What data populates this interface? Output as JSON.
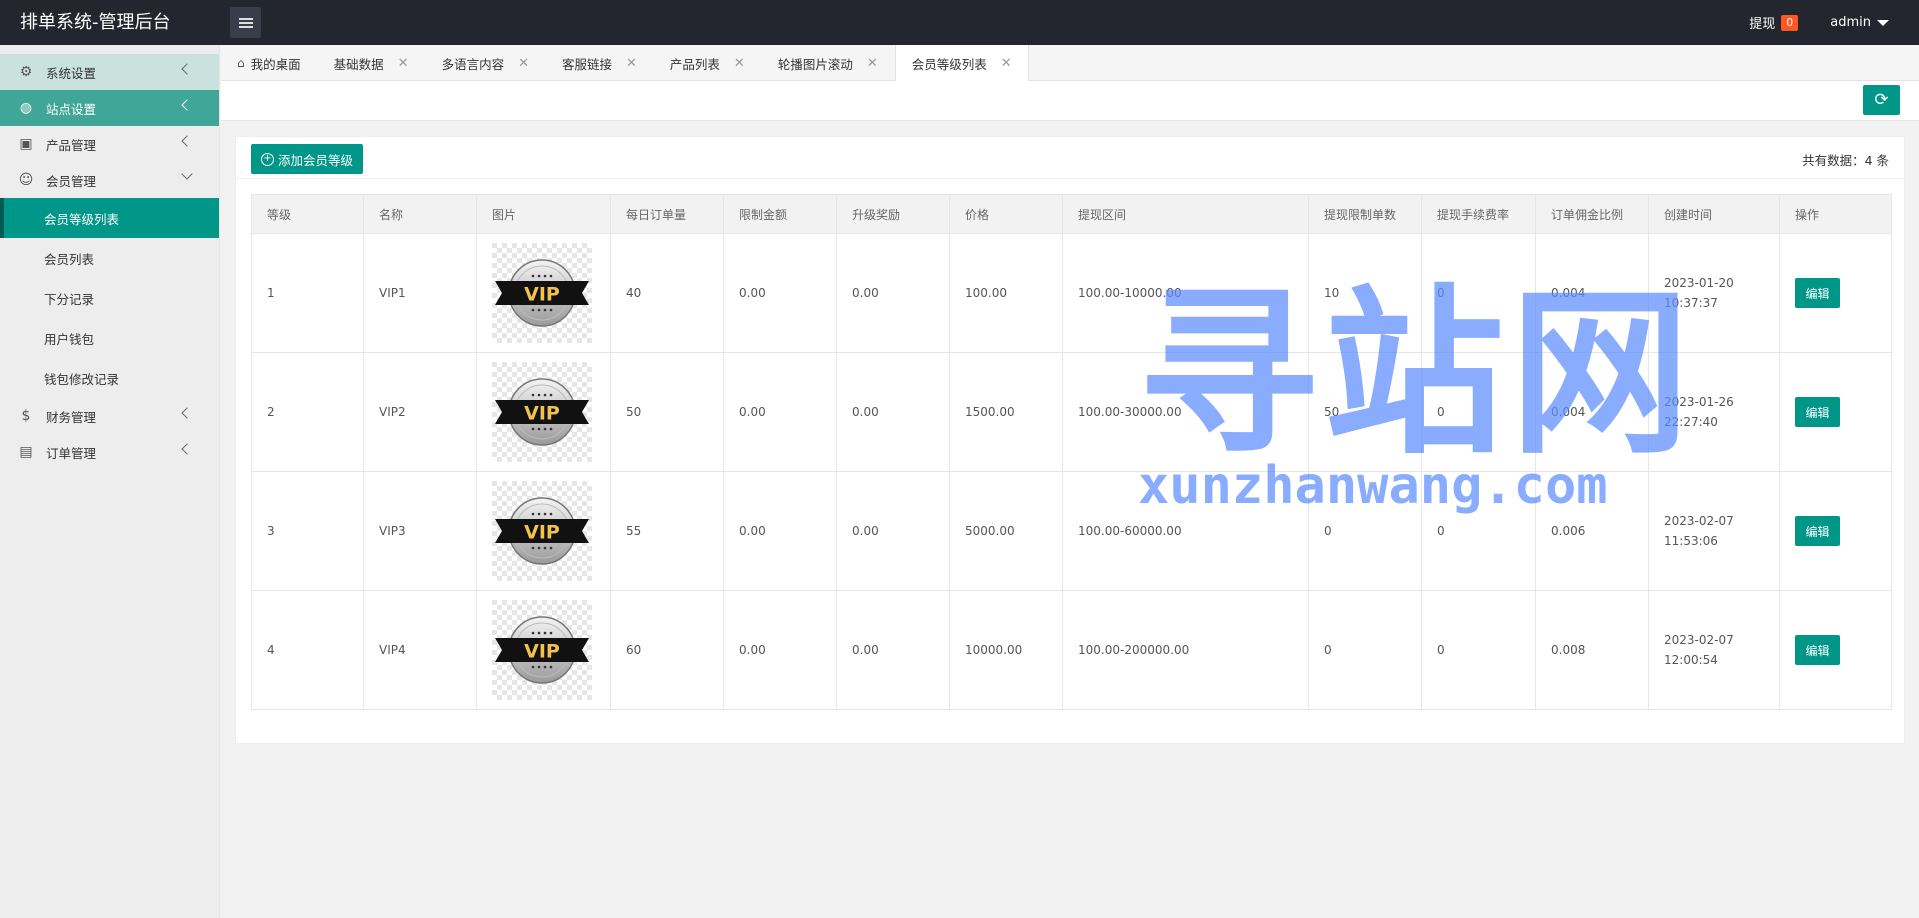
{
  "header": {
    "title": "排单系统-管理后台",
    "withdraw_label": "提现",
    "withdraw_badge": "0",
    "user": "admin"
  },
  "sidebar": {
    "items": [
      {
        "label": "系统设置",
        "icon": "gear-icon"
      },
      {
        "label": "站点设置",
        "icon": "globe-icon"
      },
      {
        "label": "产品管理",
        "icon": "box-icon"
      },
      {
        "label": "会员管理",
        "icon": "user-icon"
      },
      {
        "label": "财务管理",
        "icon": "dollar-icon"
      },
      {
        "label": "订单管理",
        "icon": "package-icon"
      }
    ],
    "subitems": [
      "会员等级列表",
      "会员列表",
      "下分记录",
      "用户钱包",
      "钱包修改记录"
    ]
  },
  "tabs": [
    "我的桌面",
    "基础数据",
    "多语言内容",
    "客服链接",
    "产品列表",
    "轮播图片滚动",
    "会员等级列表"
  ],
  "toolbar": {
    "add_label": "添加会员等级",
    "total_text": "共有数据：4 条"
  },
  "table": {
    "headers": [
      "等级",
      "名称",
      "图片",
      "每日订单量",
      "限制金额",
      "升级奖励",
      "价格",
      "提现区间",
      "提现限制单数",
      "提现手续费率",
      "订单佣金比例",
      "创建时间",
      "操作"
    ],
    "edit_label": "编辑",
    "vip_badge_text": "VIP",
    "rows": [
      {
        "level": "1",
        "name": "VIP1",
        "daily": "40",
        "limit": "0.00",
        "reward": "0.00",
        "price": "100.00",
        "range": "100.00-10000.00",
        "wd_count": "10",
        "fee": "0",
        "commission": "0.004",
        "time": "2023-01-20 10:37:37"
      },
      {
        "level": "2",
        "name": "VIP2",
        "daily": "50",
        "limit": "0.00",
        "reward": "0.00",
        "price": "1500.00",
        "range": "100.00-30000.00",
        "wd_count": "50",
        "fee": "0",
        "commission": "0.004",
        "time": "2023-01-26 22:27:40"
      },
      {
        "level": "3",
        "name": "VIP3",
        "daily": "55",
        "limit": "0.00",
        "reward": "0.00",
        "price": "5000.00",
        "range": "100.00-60000.00",
        "wd_count": "0",
        "fee": "0",
        "commission": "0.006",
        "time": "2023-02-07 11:53:06"
      },
      {
        "level": "4",
        "name": "VIP4",
        "daily": "60",
        "limit": "0.00",
        "reward": "0.00",
        "price": "10000.00",
        "range": "100.00-200000.00",
        "wd_count": "0",
        "fee": "0",
        "commission": "0.008",
        "time": "2023-02-07 12:00:54"
      }
    ]
  },
  "watermark": {
    "cn": "寻站网",
    "url": "xunzhanwang.com"
  },
  "colors": {
    "accent": "#009688",
    "header_bg": "#23262e",
    "badge": "#ff5722",
    "watermark": "#5b8cff"
  }
}
